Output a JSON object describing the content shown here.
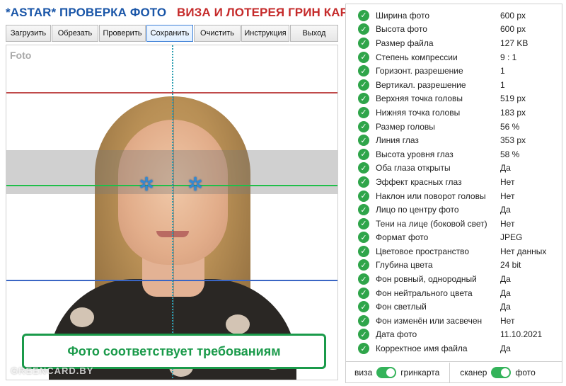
{
  "header": {
    "brand": "*ASTAR* ПРОВЕРКА ФОТО",
    "subtitle": "ВИЗА И ЛОТЕРЕЯ ГРИН КАРТА"
  },
  "toolbar": {
    "buttons": [
      {
        "label": "Загрузить"
      },
      {
        "label": "Обрезать"
      },
      {
        "label": "Проверить"
      },
      {
        "label": "Сохранить",
        "active": true
      },
      {
        "label": "Очистить"
      },
      {
        "label": "Инструкция"
      },
      {
        "label": "Выход"
      }
    ]
  },
  "photo": {
    "label": "Foto",
    "status_message": "Фото соответствует требованиям",
    "watermark": "GREENCARD.BY"
  },
  "checks": [
    {
      "label": "Ширина фото",
      "value": "600 px"
    },
    {
      "label": "Высота фото",
      "value": "600 px"
    },
    {
      "label": "Размер файла",
      "value": "127 KB"
    },
    {
      "label": "Степень компрессии",
      "value": "9 : 1"
    },
    {
      "label": "Горизонт. разрешение",
      "value": "1"
    },
    {
      "label": "Вертикал. разрешение",
      "value": "1"
    },
    {
      "label": "Верхняя точка головы",
      "value": "519 px"
    },
    {
      "label": "Нижняя точка головы",
      "value": "183 px"
    },
    {
      "label": "Размер головы",
      "value": "56 %"
    },
    {
      "label": "Линия глаз",
      "value": "353 px"
    },
    {
      "label": "Высота уровня глаз",
      "value": "58 %"
    },
    {
      "label": "Оба глаза открыты",
      "value": "Да"
    },
    {
      "label": "Эффект красных глаз",
      "value": "Нет"
    },
    {
      "label": "Наклон или поворот головы",
      "value": "Нет"
    },
    {
      "label": "Лицо по центру фото",
      "value": "Да"
    },
    {
      "label": "Тени на лице (боковой свет)",
      "value": "Нет"
    },
    {
      "label": "Формат фото",
      "value": "JPEG"
    },
    {
      "label": "Цветовое пространство",
      "value": "Нет данных"
    },
    {
      "label": "Глубина цвета",
      "value": "24 bit"
    },
    {
      "label": "Фон ровный, однородный",
      "value": "Да"
    },
    {
      "label": "Фон нейтрального цвета",
      "value": "Да"
    },
    {
      "label": "Фон светлый",
      "value": "Да"
    },
    {
      "label": "Фон изменён или засвечен",
      "value": "Нет"
    },
    {
      "label": "Дата фото",
      "value": "11.10.2021"
    },
    {
      "label": "Корректное имя файла",
      "value": "Да"
    }
  ],
  "toggles": {
    "left": {
      "left_label": "виза",
      "right_label": "гринкарта",
      "on": true
    },
    "right": {
      "left_label": "сканер",
      "right_label": "фото",
      "on": true
    }
  },
  "colors": {
    "brand_blue": "#1a56a8",
    "brand_red": "#c52a2a",
    "ok_green": "#2fa54a",
    "guide_red": "#c04a4a",
    "guide_green": "#1fbf4a",
    "guide_blue": "#3a66c4"
  }
}
